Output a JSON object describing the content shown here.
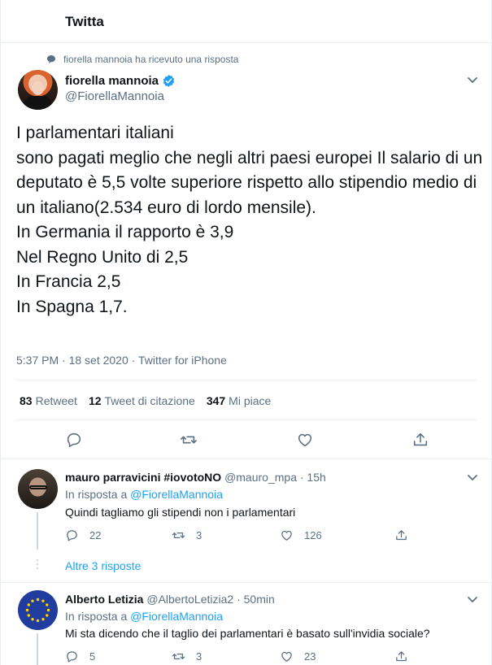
{
  "header": {
    "title": "Twitta"
  },
  "social_context": "fiorella mannoia ha ricevuto una risposta",
  "tweet": {
    "author_name": "fiorella mannoia",
    "author_handle": "@FiorellaMannoia",
    "text": "I parlamentari italiani\nsono pagati meglio che negli altri paesi europei Il salario di un deputato è 5,5 volte superiore rispetto allo stipendio medio di un italiano(2.534 euro di lordo mensile).\nIn Germania il rapporto è 3,9\nNel Regno Unito di 2,5\nIn Francia 2,5\nIn Spagna 1,7.",
    "meta": "5:37 PM · 18 set 2020 · Twitter for iPhone",
    "stats": {
      "retweets_count": "83",
      "retweets_label": "Retweet",
      "quotes_count": "12",
      "quotes_label": "Tweet di citazione",
      "likes_count": "347",
      "likes_label": "Mi piace"
    },
    "icons": [
      "reply-icon",
      "retweet-icon",
      "like-icon",
      "share-icon"
    ]
  },
  "replies": [
    {
      "name": "mauro parravicini #iovotoNO",
      "handle": "@mauro_mpa",
      "time": "· 15h",
      "reply_to_label": "In risposta a",
      "reply_to_mention": "@FiorellaMannoia",
      "text": "Quindi tagliamo gli stipendi non i parlamentari",
      "reply_count": "22",
      "retweet_count": "3",
      "like_count": "126"
    },
    {
      "name": "Alberto Letizia",
      "handle": "@AlbertoLetizia2",
      "time": "· 50min",
      "reply_to_label": "In risposta a",
      "reply_to_mention": "@FiorellaMannoia",
      "text": "Mi sta dicendo che il taglio dei parlamentari è basato sull'invidia sociale?",
      "reply_count": "5",
      "retweet_count": "3",
      "like_count": "23"
    }
  ],
  "more_replies": "Altre 3 risposte",
  "colors": {
    "accent": "#1da1f2",
    "secondary_text": "#5b7083",
    "border": "#ebeef0"
  }
}
